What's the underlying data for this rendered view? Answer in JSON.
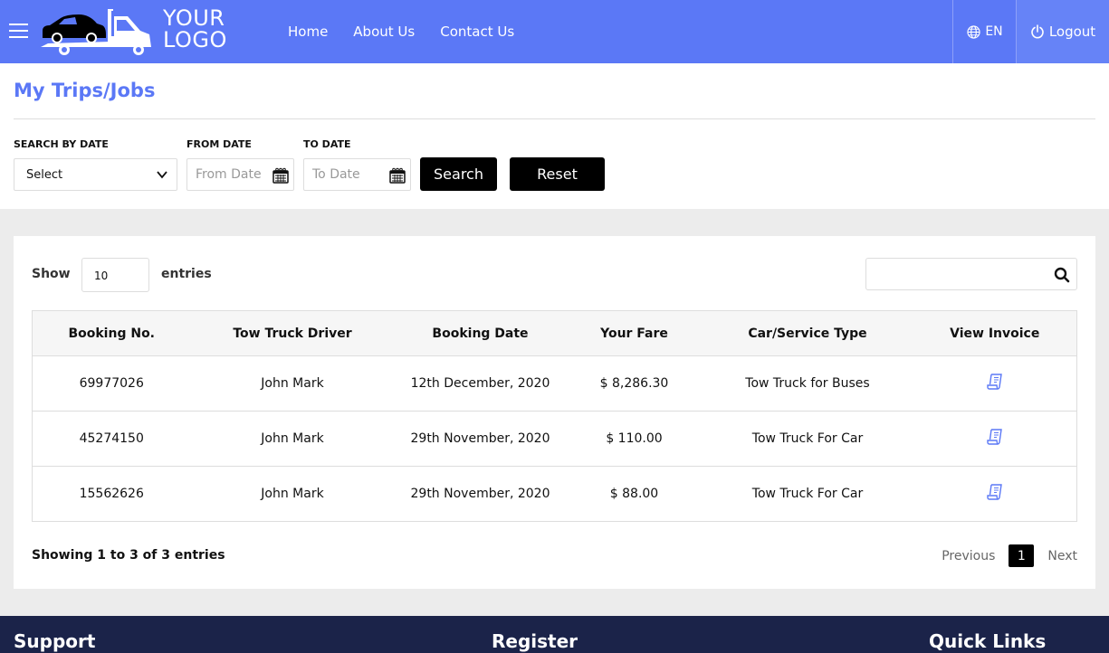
{
  "header": {
    "logo_text_line1": "YOUR",
    "logo_text_line2": "LOGO",
    "nav": [
      {
        "label": "Home"
      },
      {
        "label": "About Us"
      },
      {
        "label": "Contact Us"
      }
    ],
    "language": "EN",
    "logout_label": "Logout",
    "brand_color": "#5b78f6"
  },
  "page": {
    "title": "My Trips/Jobs"
  },
  "filters": {
    "search_by_date_label": "SEARCH BY DATE",
    "search_by_date_value": "Select",
    "from_date_label": "FROM DATE",
    "from_date_placeholder": "From Date",
    "to_date_label": "TO DATE",
    "to_date_placeholder": "To Date",
    "search_button": "Search",
    "reset_button": "Reset"
  },
  "table_controls": {
    "show_label": "Show",
    "entries_value": "10",
    "entries_label": "entries",
    "search_value": ""
  },
  "table": {
    "columns": [
      "Booking No.",
      "Tow Truck Driver",
      "Booking Date",
      "Your Fare",
      "Car/Service Type",
      "View Invoice"
    ],
    "rows": [
      {
        "booking_no": "69977026",
        "driver": "John Mark",
        "date": "12th December, 2020",
        "fare": "$ 8,286.30",
        "service": "Tow Truck for Buses",
        "invoice_icon": "invoice-icon"
      },
      {
        "booking_no": "45274150",
        "driver": "John Mark",
        "date": "29th November, 2020",
        "fare": "$ 110.00",
        "service": "Tow Truck For Car",
        "invoice_icon": "invoice-icon"
      },
      {
        "booking_no": "15562626",
        "driver": "John Mark",
        "date": "29th November, 2020",
        "fare": "$ 88.00",
        "service": "Tow Truck For Car",
        "invoice_icon": "invoice-icon"
      }
    ]
  },
  "pagination": {
    "summary": "Showing 1 to 3 of 3 entries",
    "previous": "Previous",
    "current": "1",
    "next": "Next"
  },
  "footer": {
    "col1": "Support",
    "col2": "Register",
    "col3": "Quick Links"
  }
}
